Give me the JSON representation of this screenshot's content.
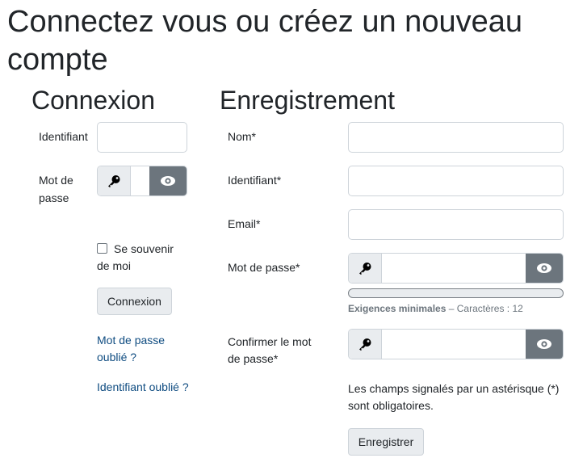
{
  "page_title": "Connectez vous ou créez un nouveau compte",
  "login": {
    "heading": "Connexion",
    "username_label": "Identifiant",
    "password_label": "Mot de passe",
    "remember_label": "Se souvenir de moi",
    "submit_label": "Connexion",
    "forgot_password": "Mot de passe oublié ?",
    "forgot_username": "Identifiant oublié ?"
  },
  "register": {
    "heading": "Enregistrement",
    "name_label": "Nom*",
    "username_label": "Identifiant*",
    "email_label": "Email*",
    "password_label": "Mot de passe*",
    "requirements_title": "Exigences minimales",
    "requirements_detail": "– Caractères : 12",
    "confirm_label": "Confirmer le mot de passe*",
    "required_note": "Les champs signalés par un astérisque (*) sont obligatoires.",
    "submit_label": "Enregistrer"
  },
  "icons": {
    "key": "key-icon",
    "eye": "eye-icon"
  },
  "colors": {
    "link": "#0f4c81",
    "eye_addon": "#6c757d",
    "key_addon": "#e9ecef"
  }
}
